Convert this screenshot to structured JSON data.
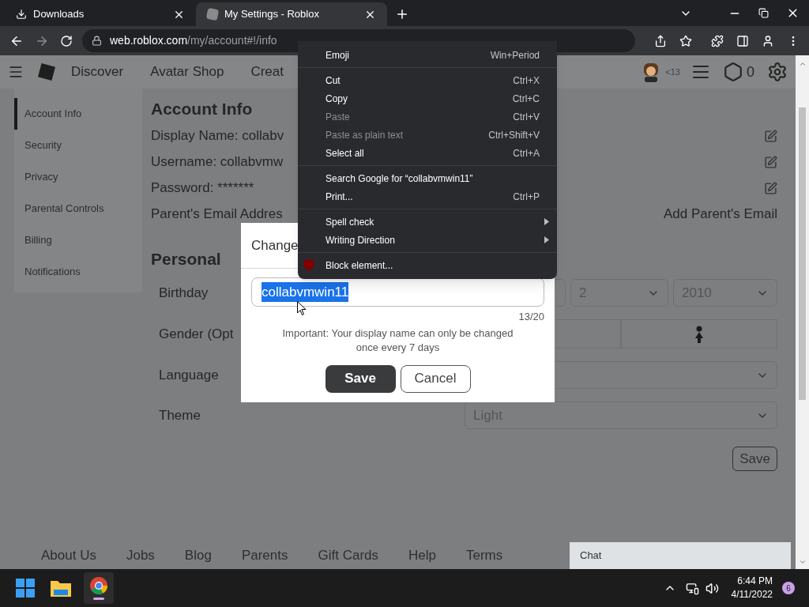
{
  "browser": {
    "tabs": [
      {
        "title": "Downloads",
        "kind": "downloads",
        "selected": false
      },
      {
        "title": "My Settings - Roblox",
        "kind": "site",
        "selected": true
      }
    ],
    "address": {
      "host": "web.roblox.com",
      "path": "/my/account#!/info"
    }
  },
  "header": {
    "nav": [
      "Discover",
      "Avatar Shop",
      "Creat"
    ],
    "age_label": "<13",
    "robux": "0"
  },
  "sidebar": {
    "items": [
      {
        "label": "Account Info",
        "selected": true
      },
      {
        "label": "Security",
        "selected": false
      },
      {
        "label": "Privacy",
        "selected": false
      },
      {
        "label": "Parental Controls",
        "selected": false
      },
      {
        "label": "Billing",
        "selected": false
      },
      {
        "label": "Notifications",
        "selected": false
      }
    ]
  },
  "account": {
    "title": "Account Info",
    "rows": [
      {
        "text": "Display Name: collabv",
        "editable": true
      },
      {
        "text": "Username: collabvmw",
        "editable": true
      },
      {
        "text": "Password: *******",
        "editable": true
      },
      {
        "text": "Parent's Email Addres",
        "editable": false,
        "action": "Add Parent's Email"
      }
    ]
  },
  "personal": {
    "title": "Personal",
    "birthday": {
      "label": "Birthday",
      "day": "2",
      "year": "2010"
    },
    "gender": {
      "label": "Gender (Opt"
    },
    "language": {
      "label": "Language"
    },
    "theme": {
      "label": "Theme",
      "value": "Light"
    },
    "save": "Save"
  },
  "footer": [
    "About Us",
    "Jobs",
    "Blog",
    "Parents",
    "Gift Cards",
    "Help",
    "Terms"
  ],
  "chat": "Chat",
  "dialog": {
    "title": "Change",
    "value": "collabvmwin11",
    "selected_text": true,
    "counter": "13/20",
    "note": "Important: Your display name can only be changed once every 7 days",
    "buttons": [
      {
        "label": "Save",
        "kind": "primary"
      },
      {
        "label": "Cancel",
        "kind": "secondary"
      }
    ]
  },
  "context_menu": {
    "groups": [
      [
        {
          "label": "Emoji",
          "shortcut": "Win+Period",
          "kind": "command",
          "disabled": false
        }
      ],
      [
        {
          "label": "Cut",
          "shortcut": "Ctrl+X",
          "kind": "command",
          "disabled": false
        },
        {
          "label": "Copy",
          "shortcut": "Ctrl+C",
          "kind": "command",
          "disabled": false
        },
        {
          "label": "Paste",
          "shortcut": "Ctrl+V",
          "kind": "command",
          "disabled": true
        },
        {
          "label": "Paste as plain text",
          "shortcut": "Ctrl+Shift+V",
          "kind": "command",
          "disabled": true
        },
        {
          "label": "Select all",
          "shortcut": "Ctrl+A",
          "kind": "command",
          "disabled": false
        }
      ],
      [
        {
          "label": "Search Google for “collabvmwin11”",
          "kind": "command",
          "disabled": false
        },
        {
          "label": "Print...",
          "shortcut": "Ctrl+P",
          "kind": "command",
          "disabled": false
        }
      ],
      [
        {
          "label": "Spell check",
          "kind": "submenu",
          "disabled": false
        },
        {
          "label": "Writing Direction",
          "kind": "submenu",
          "disabled": false
        }
      ],
      [
        {
          "label": "Block element...",
          "kind": "extension",
          "disabled": false
        }
      ]
    ]
  },
  "taskbar": {
    "time": "6:44 PM",
    "date": "4/11/2022",
    "notifications": "6"
  }
}
